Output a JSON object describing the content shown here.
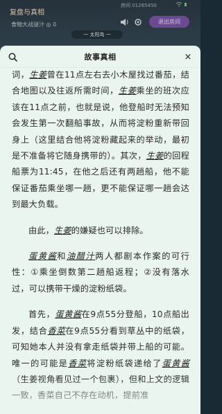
{
  "background": {
    "title": "复盘与真相",
    "room_id": "房间 01265450",
    "subtitle": "食物大战谜汁 ◎ 0",
    "exit_label": "退出房间",
    "sun_label": "一 太阳岛 一"
  },
  "modal": {
    "title": "故事真相",
    "close_label": "×"
  },
  "content": {
    "p1": {
      "t1": "词，",
      "n1": "生姜",
      "t2": "曾在11点左右去小木屋找过番茄，结合地图以及往返所需时间，",
      "n2": "生姜",
      "t3": "乘坐的班次应该在11点之前，也就是说，他登船时无法预知会发生第一次翻船事故，从而将淀粉重新带回身上（这里结合他将淀粉藏起来的举动，最初是不准备将它随身携带的）。其次，",
      "n3": "生姜",
      "t4": "的回程船票为11:45，在他之后还有两趟船，他不能保证番茄乘坐哪一趟，更不能保证哪一趟会达到最大负载。"
    },
    "p2": {
      "t1": "由此，",
      "n1": "生姜",
      "t2": "的嫌疑也可以排除。"
    },
    "p3": {
      "n1": "蛋黄酱",
      "t1": "和",
      "n2": "油醋汁",
      "t2": "两人都剧本作案的可行性：①乘坐倒数第二趟船返程；②没有落水过，可以携带干燥的淀粉纸袋。"
    },
    "p4": {
      "t1": "首先，",
      "n1": "蛋黄酱",
      "t2": "在9点55分登船，10点船出发，结合",
      "n2": "香菜",
      "t3": "在9点55分看到草丛中的纸袋，可知她本人并没有拿走纸袋并带上船的可能。唯一的可能是",
      "n3": "香菜",
      "t4": "将淀粉纸袋递给了",
      "n4": "蛋黄酱",
      "t5": "（生姜视角看见过一个包裹），但和上文的逻辑一致，香菜自己不存在动机，提前准"
    }
  }
}
